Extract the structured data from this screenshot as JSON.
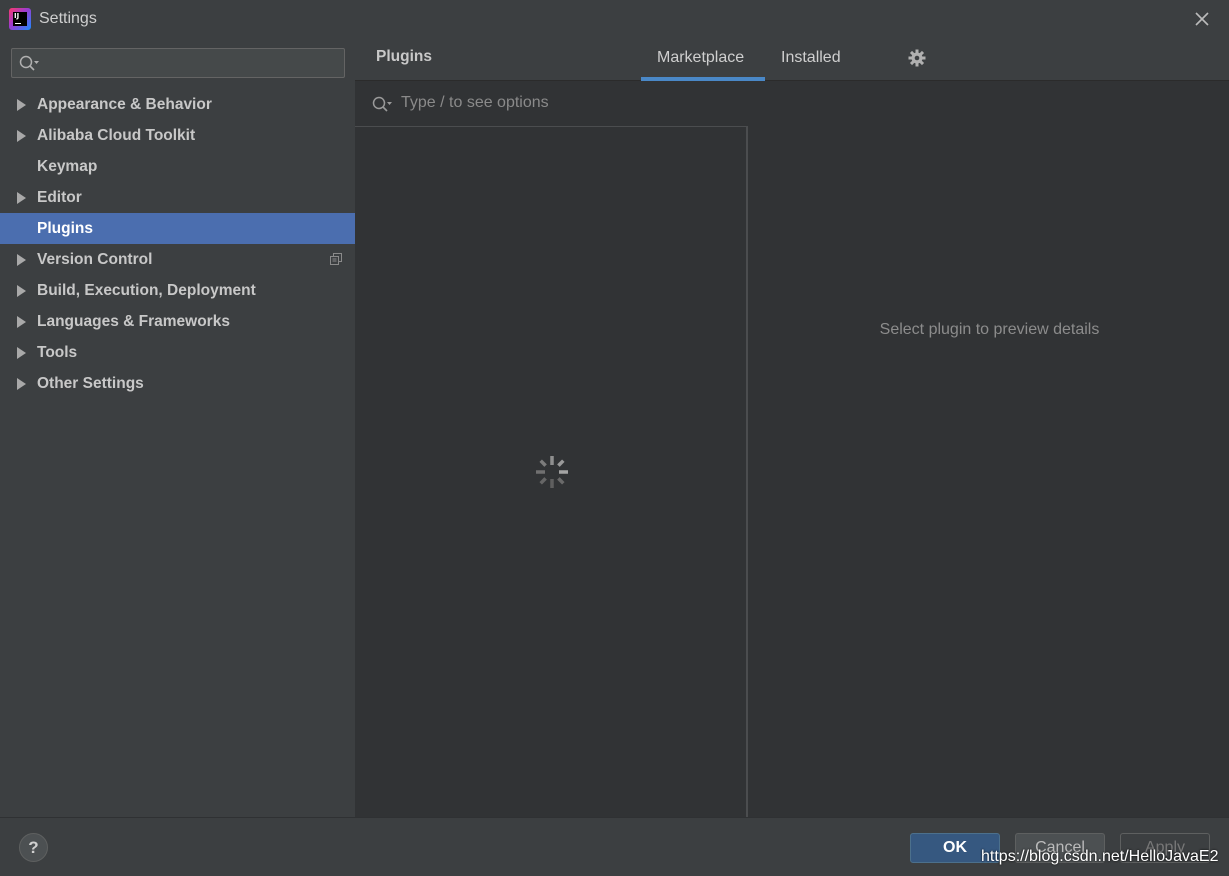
{
  "window": {
    "title": "Settings",
    "app_icon_text": "IJ"
  },
  "sidebar": {
    "search": {
      "value": "",
      "placeholder": ""
    },
    "items": [
      {
        "label": "Appearance & Behavior",
        "expandable": true
      },
      {
        "label": "Alibaba Cloud Toolkit",
        "expandable": true
      },
      {
        "label": "Keymap",
        "expandable": false
      },
      {
        "label": "Editor",
        "expandable": true
      },
      {
        "label": "Plugins",
        "expandable": false,
        "selected": true
      },
      {
        "label": "Version Control",
        "expandable": true,
        "icon": "copy-icon"
      },
      {
        "label": "Build, Execution, Deployment",
        "expandable": true
      },
      {
        "label": "Languages & Frameworks",
        "expandable": true
      },
      {
        "label": "Tools",
        "expandable": true
      },
      {
        "label": "Other Settings",
        "expandable": true
      }
    ]
  },
  "main": {
    "title": "Plugins",
    "tabs": [
      {
        "label": "Marketplace",
        "active": true
      },
      {
        "label": "Installed",
        "active": false
      }
    ],
    "settings_icon": "gear-icon",
    "search": {
      "placeholder": "Type / to see options"
    },
    "loading_icon": "spinner-icon",
    "detail_placeholder": "Select plugin to preview details"
  },
  "footer": {
    "help_label": "?",
    "ok_label": "OK",
    "cancel_label": "Cancel",
    "apply_label": "Apply",
    "watermark": "https://blog.csdn.net/HelloJavaE2"
  },
  "colors": {
    "selection": "#4b6eaf",
    "tab_underline": "#4a88c7",
    "ok_button": "#365880"
  }
}
